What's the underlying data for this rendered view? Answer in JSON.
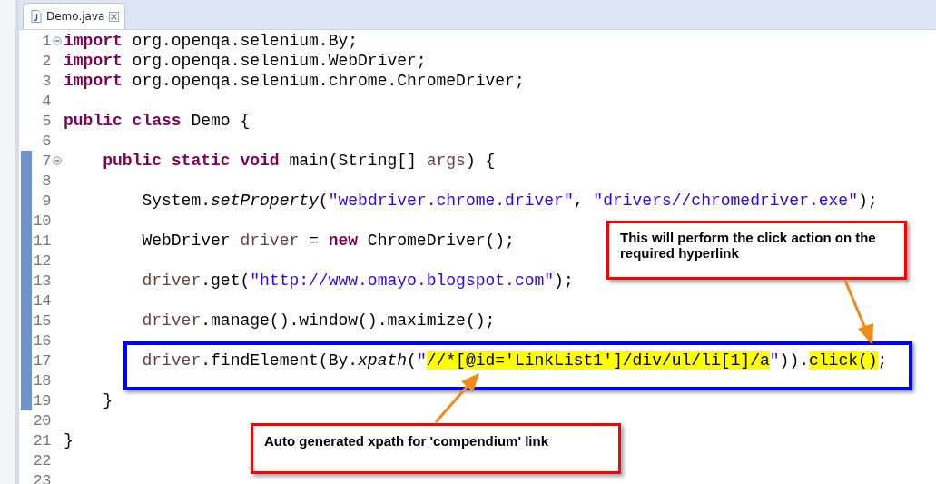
{
  "tab": {
    "title": "Demo.java",
    "selected": true
  },
  "lines": [
    {
      "number": "1",
      "fold": true,
      "changed": false,
      "tokens": [
        {
          "kind": "keyword",
          "text": "import"
        },
        {
          "kind": "plain",
          "text": " org.openqa.selenium.By;"
        }
      ]
    },
    {
      "number": "2",
      "fold": false,
      "changed": false,
      "tokens": [
        {
          "kind": "keyword",
          "text": "import"
        },
        {
          "kind": "plain",
          "text": " org.openqa.selenium.WebDriver;"
        }
      ]
    },
    {
      "number": "3",
      "fold": false,
      "changed": false,
      "tokens": [
        {
          "kind": "keyword",
          "text": "import"
        },
        {
          "kind": "plain",
          "text": " org.openqa.selenium.chrome.ChromeDriver;"
        }
      ]
    },
    {
      "number": "4",
      "fold": false,
      "changed": false
    },
    {
      "number": "5",
      "fold": false,
      "changed": false,
      "tokens": [
        {
          "kind": "keyword",
          "text": "public class"
        },
        {
          "kind": "plain",
          "text": " Demo {"
        }
      ]
    },
    {
      "number": "6",
      "fold": false,
      "changed": false
    },
    {
      "number": "7",
      "fold": true,
      "changed": true,
      "tokens": [
        {
          "kind": "keyword",
          "text": "    public static void"
        },
        {
          "kind": "plain",
          "text": " main(String[] "
        },
        {
          "kind": "variable",
          "text": "args"
        },
        {
          "kind": "plain",
          "text": ") {"
        }
      ]
    },
    {
      "number": "8",
      "fold": false,
      "changed": true
    },
    {
      "number": "9",
      "fold": false,
      "changed": true,
      "tokens": [
        {
          "kind": "plain",
          "text": "        System."
        },
        {
          "kind": "static",
          "text": "setProperty"
        },
        {
          "kind": "plain",
          "text": "("
        },
        {
          "kind": "string",
          "text": "\"webdriver.chrome.driver\""
        },
        {
          "kind": "plain",
          "text": ", "
        },
        {
          "kind": "string",
          "text": "\"drivers//chromedriver.exe\""
        },
        {
          "kind": "plain",
          "text": ");"
        }
      ]
    },
    {
      "number": "10",
      "fold": false,
      "changed": true
    },
    {
      "number": "11",
      "fold": false,
      "changed": true,
      "tokens": [
        {
          "kind": "plain",
          "text": "        WebDriver "
        },
        {
          "kind": "variable",
          "text": "driver"
        },
        {
          "kind": "plain",
          "text": " = "
        },
        {
          "kind": "keyword",
          "text": "new"
        },
        {
          "kind": "plain",
          "text": " ChromeDriver();"
        }
      ]
    },
    {
      "number": "12",
      "fold": false,
      "changed": true
    },
    {
      "number": "13",
      "fold": false,
      "changed": true,
      "tokens": [
        {
          "kind": "variable",
          "text": "        driver"
        },
        {
          "kind": "plain",
          "text": ".get("
        },
        {
          "kind": "string",
          "text": "\"http://www.omayo.blogspot.com\""
        },
        {
          "kind": "plain",
          "text": ");"
        }
      ]
    },
    {
      "number": "14",
      "fold": false,
      "changed": true
    },
    {
      "number": "15",
      "fold": false,
      "changed": true,
      "tokens": [
        {
          "kind": "variable",
          "text": "        driver"
        },
        {
          "kind": "plain",
          "text": ".manage().window().maximize();"
        }
      ]
    },
    {
      "number": "16",
      "fold": false,
      "changed": true
    },
    {
      "number": "17",
      "fold": false,
      "changed": true,
      "tokens": [
        {
          "kind": "variable",
          "text": "        driver"
        },
        {
          "kind": "plain",
          "text": ".findElement(By."
        },
        {
          "kind": "static",
          "text": "xpath"
        },
        {
          "kind": "plain",
          "text": "("
        },
        {
          "kind": "string",
          "text": "\""
        },
        {
          "kind": "plain",
          "text": "//*[@id='LinkList1']/div/ul/li[1]/a",
          "highlight": true
        },
        {
          "kind": "string",
          "text": "\""
        },
        {
          "kind": "plain",
          "text": "))."
        },
        {
          "kind": "plain",
          "text": "click()",
          "highlight": true
        },
        {
          "kind": "plain",
          "text": ";"
        }
      ]
    },
    {
      "number": "18",
      "fold": false,
      "changed": true
    },
    {
      "number": "19",
      "fold": false,
      "changed": true,
      "tokens": [
        {
          "kind": "plain",
          "text": "    }"
        }
      ]
    },
    {
      "number": "20",
      "fold": false,
      "changed": false
    },
    {
      "number": "21",
      "fold": false,
      "changed": false,
      "tokens": [
        {
          "kind": "plain",
          "text": "}"
        }
      ]
    },
    {
      "number": "22",
      "fold": false,
      "changed": false
    },
    {
      "number": "23",
      "fold": false,
      "changed": false
    }
  ],
  "callouts": [
    {
      "text": "This will perform the click action on the required hyperlink"
    },
    {
      "text": "Auto generated xpath for 'compendium' link"
    }
  ]
}
